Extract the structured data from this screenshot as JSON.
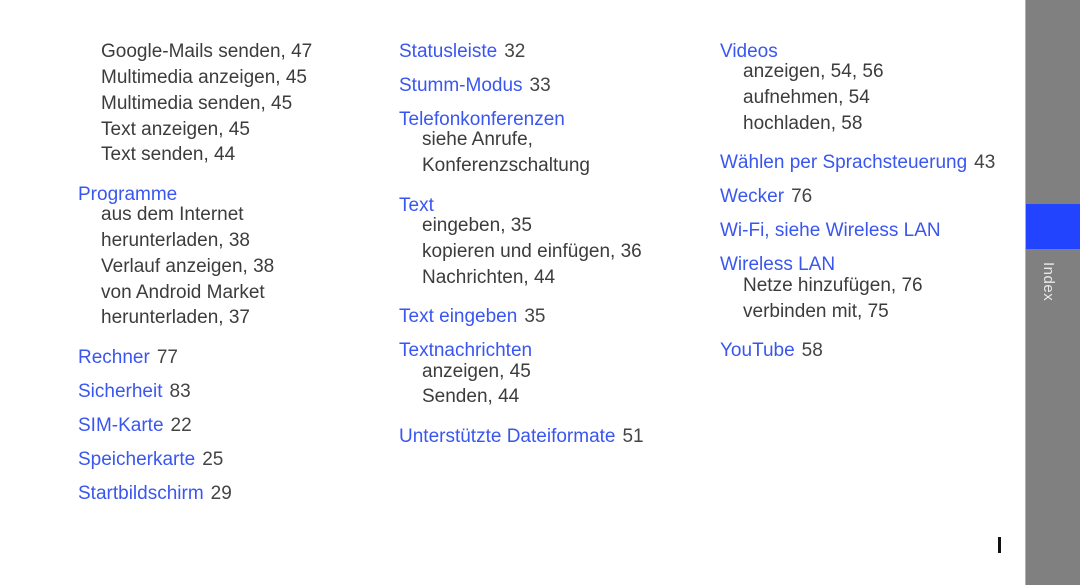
{
  "col1": {
    "pre_subs": [
      "Google-Mails senden, 47",
      "Multimedia anzeigen, 45",
      "Multimedia senden, 45",
      "Text anzeigen, 45",
      "Text senden, 44"
    ],
    "programme": {
      "term": "Programme",
      "subs": [
        "aus dem Internet",
        "herunterladen, 38",
        "Verlauf anzeigen, 38",
        "von Android Market",
        "herunterladen, 37"
      ]
    },
    "entries": [
      {
        "term": "Rechner",
        "num": "77"
      },
      {
        "term": "Sicherheit",
        "num": "83"
      },
      {
        "term": "SIM-Karte",
        "num": "22"
      },
      {
        "term": "Speicherkarte",
        "num": "25"
      },
      {
        "term": "Startbildschirm",
        "num": "29"
      }
    ]
  },
  "col2": {
    "statusleiste": {
      "term": "Statusleiste",
      "num": "32"
    },
    "stumm": {
      "term": "Stumm-Modus",
      "num": "33"
    },
    "telefon": {
      "term": "Telefonkonferenzen",
      "subs": [
        "siehe Anrufe,",
        "Konferenzschaltung"
      ]
    },
    "text": {
      "term": "Text",
      "subs": [
        "eingeben, 35",
        "kopieren und einfügen, 36",
        "Nachrichten, 44"
      ]
    },
    "text_eingeben": {
      "term": "Text eingeben",
      "num": "35"
    },
    "textnachrichten": {
      "term": "Textnachrichten",
      "subs": [
        "anzeigen, 45",
        "Senden, 44"
      ]
    },
    "dateiformate": {
      "term": "Unterstützte Dateiformate",
      "num": "51"
    }
  },
  "col3": {
    "videos": {
      "term": "Videos",
      "subs": [
        "anzeigen, 54, 56",
        "aufnehmen, 54",
        "hochladen, 58"
      ]
    },
    "waehlen": {
      "term": "Wählen per Sprachsteuerung",
      "num": "43"
    },
    "wecker": {
      "term": "Wecker",
      "num": "76"
    },
    "wifi": {
      "term": "Wi-Fi, siehe Wireless LAN"
    },
    "wlan": {
      "term": "Wireless LAN",
      "subs": [
        "Netze hinzufügen, 76",
        "verbinden mit, 75"
      ]
    },
    "youtube": {
      "term": "YouTube",
      "num": "58"
    }
  },
  "sidebar": {
    "label": "Index"
  },
  "colors": {
    "link": "#3a56f0",
    "tab": "#2244ff",
    "sidebar": "#808080"
  }
}
